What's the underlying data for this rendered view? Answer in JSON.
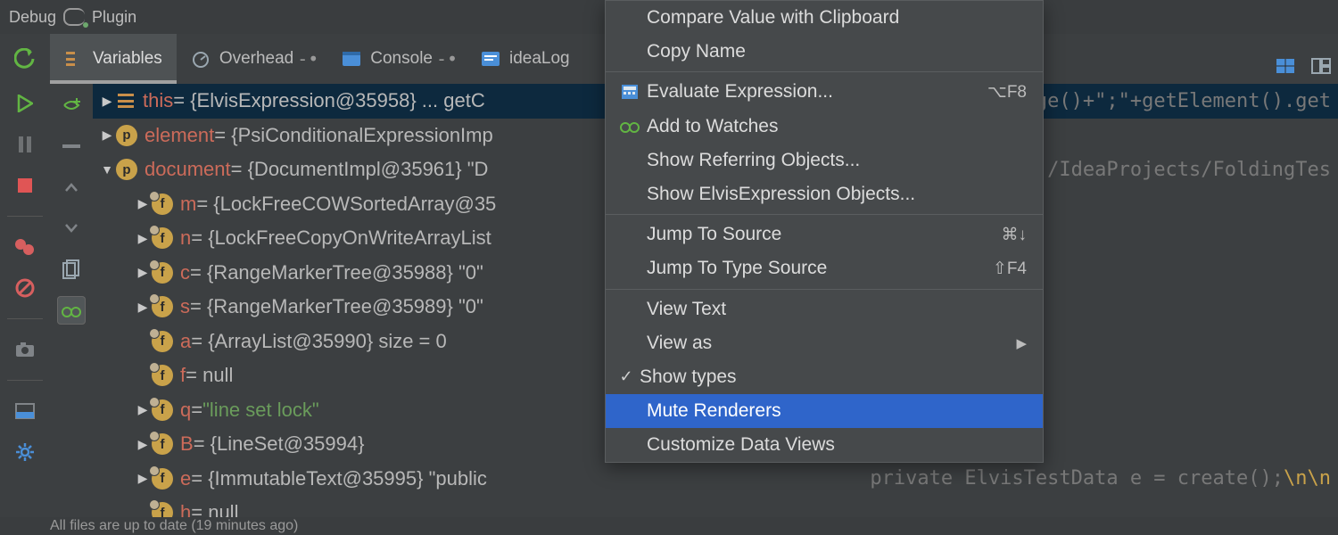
{
  "title": {
    "debug": "Debug",
    "plugin": "Plugin"
  },
  "tabs": {
    "variables": "Variables",
    "overhead": "Overhead",
    "console": "Console",
    "idealog": "ideaLog"
  },
  "vars": {
    "this_name": "this",
    "this_val": " = {ElvisExpression@35958}  ... getC",
    "this_tail": "nge()+\";\"+getElement().get",
    "element_name": "element",
    "element_val": " = {PsiConditionalExpressionImp",
    "document_name": "document",
    "document_val": " = {DocumentImpl@35961} \"D",
    "document_tail": "/IdeaProjects/FoldingTes",
    "m_name": "m",
    "m_val": " = {LockFreeCOWSortedArray@35",
    "n_name": "n",
    "n_val": " = {LockFreeCopyOnWriteArrayList",
    "c_name": "c",
    "c_val": " = {RangeMarkerTree@35988} \"0\"",
    "s_name": "s",
    "s_val": " = {RangeMarkerTree@35989} \"0\"",
    "a_name": "a",
    "a_val": " = {ArrayList@35990}  size = 0",
    "f_name": "f",
    "f_val": " = null",
    "q_name": "q",
    "q_val_pre": " = ",
    "q_str": "\"line set lock\"",
    "B_name": "B",
    "B_val": " = {LineSet@35994}",
    "e_name": "e",
    "e_val": " = {ImmutableText@35995} \"public",
    "e_tail_pre": "private ElvisTestData e = create();",
    "e_tail_post": "\\n\\n",
    "h_name": "h",
    "h_val": " = null"
  },
  "menu": {
    "compare": "Compare Value with Clipboard",
    "copy": "Copy Name",
    "evaluate": "Evaluate Expression...",
    "evaluate_key": "⌥F8",
    "watch": "Add to Watches",
    "refer": "Show Referring Objects...",
    "elvis": "Show ElvisExpression Objects...",
    "jump": "Jump To Source",
    "jump_key": "⌘↓",
    "jtype": "Jump To Type Source",
    "jtype_key": "⇧F4",
    "viewtext": "View Text",
    "viewas": "View as",
    "showtypes": "Show types",
    "mute": "Mute Renderers",
    "custom": "Customize Data Views"
  },
  "status": "All files are up to date (19 minutes ago)"
}
